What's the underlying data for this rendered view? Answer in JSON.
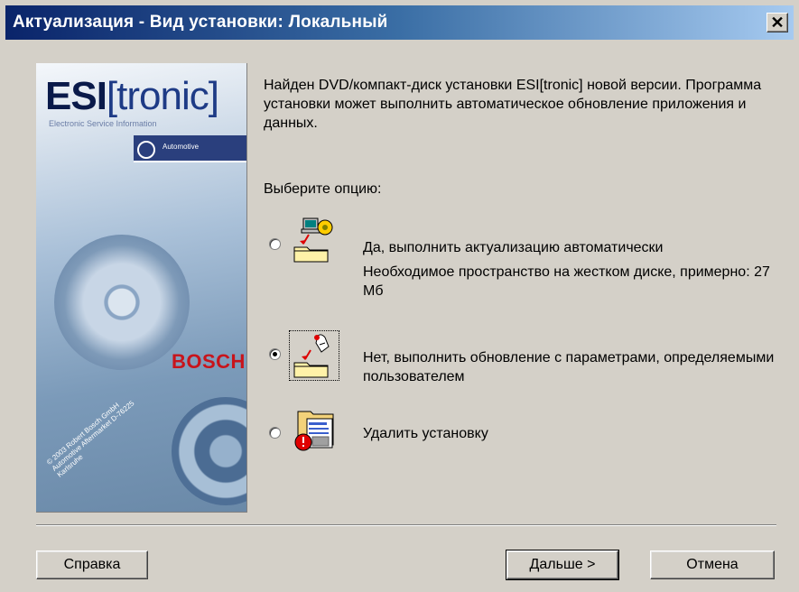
{
  "window": {
    "title": "Актуализация - Вид установки: Локальный",
    "close_glyph": "✕"
  },
  "cover": {
    "logo_main": "ESI",
    "logo_bracket": "[tronic]",
    "subtitle": "Electronic Service Information",
    "band_text": "Automotive",
    "brand": "BOSCH",
    "copyright": "© 2003 Robert Bosch GmbH Automotive Aftermarket D-76225 Karlsruhe"
  },
  "intro_text": "Найден DVD/компакт-диск установки ESI[tronic] новой версии. Программа установки может выполнить автоматическое обновление приложения и данных.",
  "choose_label": "Выберите опцию:",
  "options": [
    {
      "label": "Да, выполнить актуализацию автоматически",
      "note": "Необходимое пространство на жестком диске, примерно: 27 Мб",
      "checked": false,
      "icon": "auto-update-icon"
    },
    {
      "label": "Нет, выполнить обновление с параметрами, определяемыми пользователем",
      "checked": true,
      "icon": "custom-update-icon"
    },
    {
      "label": "Удалить установку",
      "checked": false,
      "icon": "remove-install-icon"
    }
  ],
  "buttons": {
    "help": "Справка",
    "next": "Дальше >",
    "cancel": "Отмена"
  }
}
